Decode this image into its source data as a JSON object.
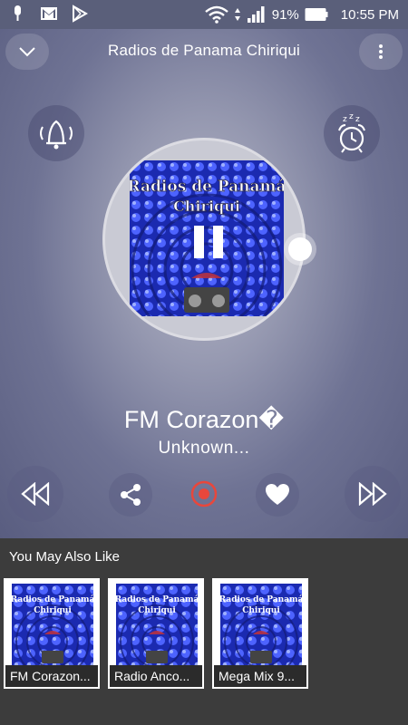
{
  "status_bar": {
    "battery": "91%",
    "time": "10:55 PM",
    "left_icons": [
      "podcast-mic-icon",
      "gmail-icon",
      "play-store-icon"
    ],
    "right_icons": [
      "wifi-icon",
      "signal-icon",
      "battery-icon"
    ]
  },
  "header": {
    "title": "Radios de Panama Chiriqui",
    "collapse_icon": "chevron-down-icon",
    "menu_icon": "more-vert-icon"
  },
  "artwork": {
    "line1": "Radios de Panamá",
    "line2": "Chiriqui"
  },
  "player": {
    "station": "FM Corazon�",
    "artist": "Unknown...",
    "state_icon": "pause-icon",
    "progress": 0.1
  },
  "controls": {
    "bell_icon": "bell-icon",
    "alarm_icon": "sleep-alarm-icon",
    "rewind_icon": "rewind-icon",
    "share_icon": "share-icon",
    "record_icon": "record-icon",
    "favorite_icon": "heart-icon",
    "forward_icon": "fast-forward-icon"
  },
  "recommendations": {
    "title": "You May Also Like",
    "items": [
      {
        "label": "FM Corazon..."
      },
      {
        "label": "Radio Anco..."
      },
      {
        "label": "Mega Mix 9..."
      }
    ]
  },
  "colors": {
    "accent_record": "#e8473c",
    "panel_top": "#b6b8c8",
    "panel_edge": "#595d80",
    "art_blue": "#2a3bd0"
  }
}
